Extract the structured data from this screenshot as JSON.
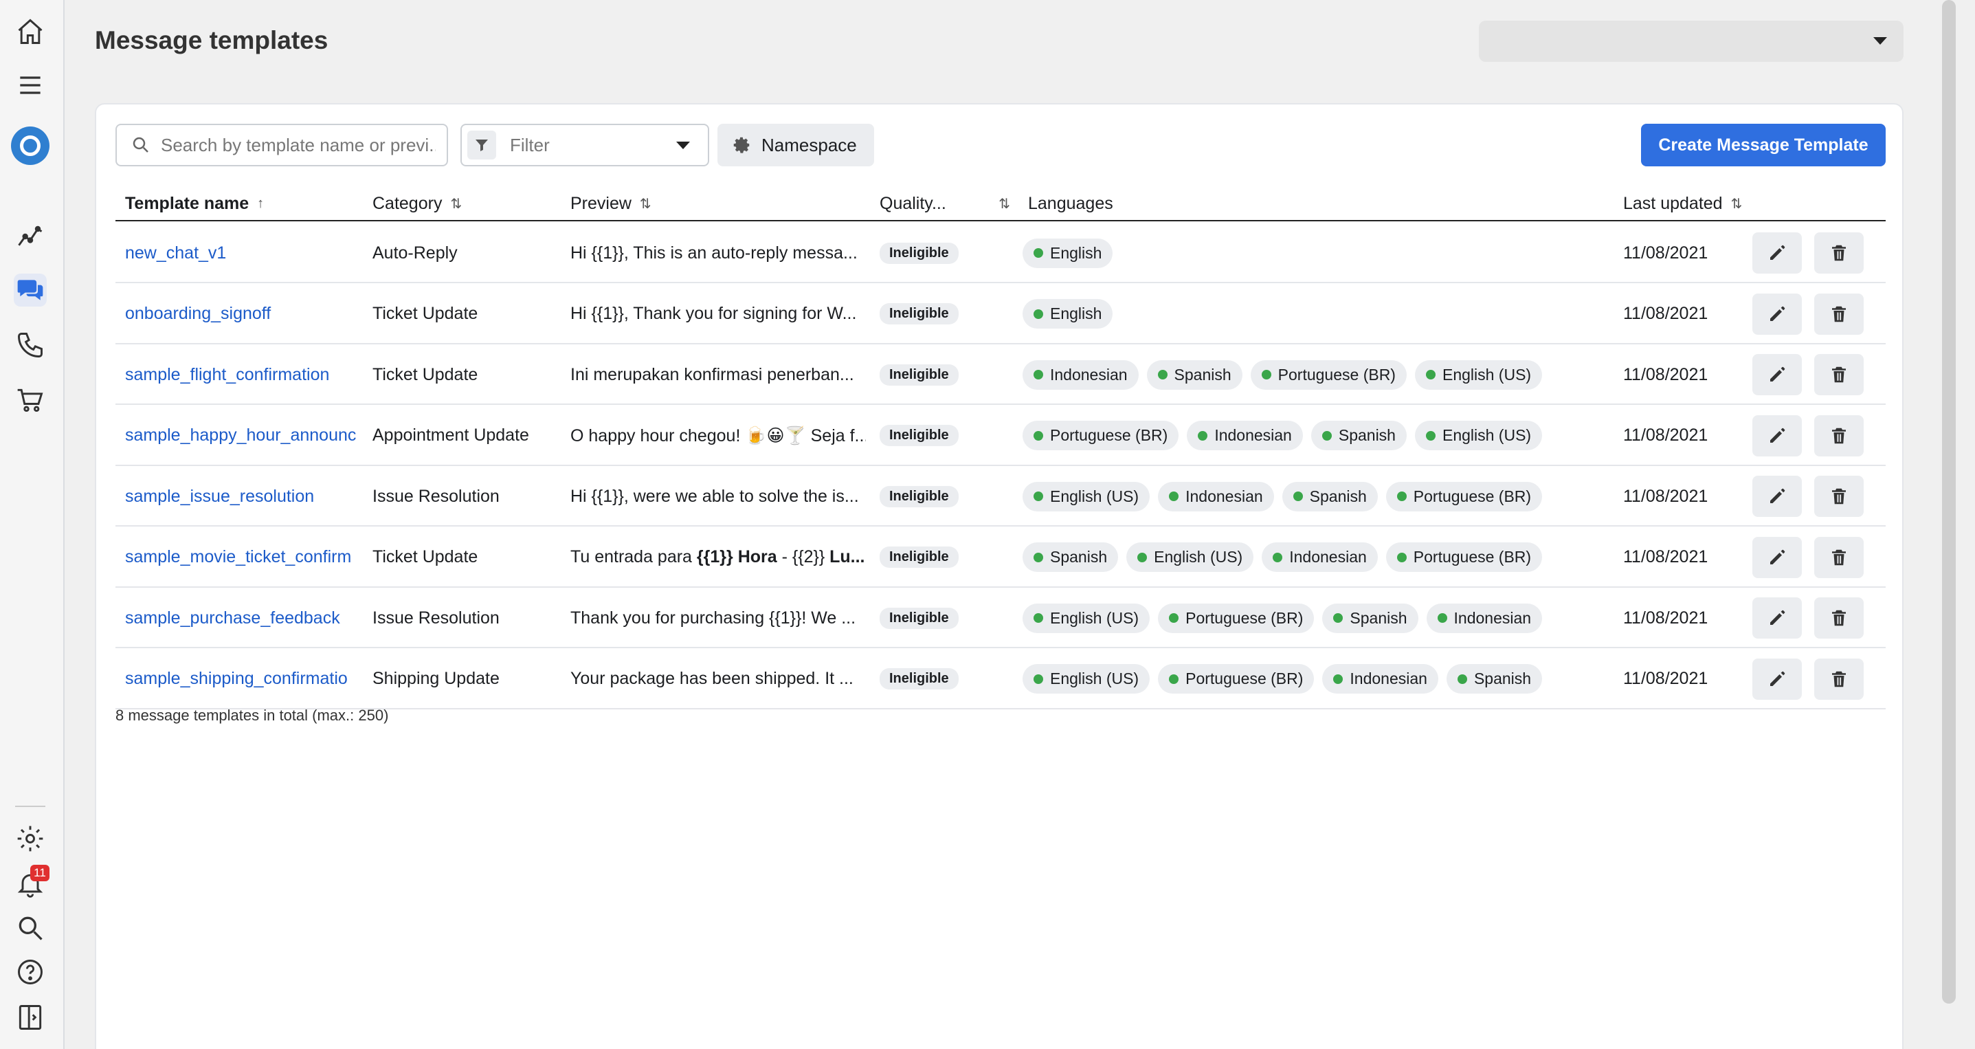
{
  "header": {
    "title": "Message templates",
    "account_select_value": ""
  },
  "sidebar": {
    "icons": [
      "home-icon",
      "menu-icon",
      "brand-logo",
      "analytics-icon",
      "chat-icon",
      "phone-icon",
      "cart-icon",
      "gear-icon",
      "bell-icon",
      "search-icon",
      "help-icon",
      "panel-toggle-icon"
    ],
    "notification_count": "11"
  },
  "toolbar": {
    "search_placeholder": "Search by template name or previ...",
    "filter_placeholder": "Filter",
    "namespace_label": "Namespace",
    "create_label": "Create Message Template"
  },
  "table": {
    "columns": {
      "name": "Template name",
      "category": "Category",
      "preview": "Preview",
      "quality": "Quality...",
      "languages": "Languages",
      "updated": "Last updated"
    },
    "sort_up_glyph": "↑",
    "sort_both_glyph": "⇅",
    "rows": [
      {
        "name": "new_chat_v1",
        "category": "Auto-Reply",
        "preview": "Hi {{1}}, This is an auto-reply messa...",
        "quality": "Ineligible",
        "languages": [
          "English"
        ],
        "updated": "11/08/2021"
      },
      {
        "name": "onboarding_signoff",
        "category": "Ticket Update",
        "preview": "Hi {{1}}, Thank you for signing for W...",
        "quality": "Ineligible",
        "languages": [
          "English"
        ],
        "updated": "11/08/2021"
      },
      {
        "name": "sample_flight_confirmation",
        "category": "Ticket Update",
        "preview": "Ini merupakan konfirmasi penerban...",
        "quality": "Ineligible",
        "languages": [
          "Indonesian",
          "Spanish",
          "Portuguese (BR)",
          "English (US)"
        ],
        "updated": "11/08/2021"
      },
      {
        "name": "sample_happy_hour_announc",
        "category": "Appointment Update",
        "preview": "O happy hour chegou! 🍺😀🍸 Seja f...",
        "quality": "Ineligible",
        "languages": [
          "Portuguese (BR)",
          "Indonesian",
          "Spanish",
          "English (US)"
        ],
        "updated": "11/08/2021"
      },
      {
        "name": "sample_issue_resolution",
        "category": "Issue Resolution",
        "preview": "Hi {{1}}, were we able to solve the is...",
        "quality": "Ineligible",
        "languages": [
          "English (US)",
          "Indonesian",
          "Spanish",
          "Portuguese (BR)"
        ],
        "updated": "11/08/2021"
      },
      {
        "name": "sample_movie_ticket_confirm",
        "category": "Ticket Update",
        "preview_parts": [
          "Tu entrada para ",
          "{{1}} Hora",
          " - {{2}} ",
          "Lu..."
        ],
        "quality": "Ineligible",
        "languages": [
          "Spanish",
          "English (US)",
          "Indonesian",
          "Portuguese (BR)"
        ],
        "updated": "11/08/2021"
      },
      {
        "name": "sample_purchase_feedback",
        "category": "Issue Resolution",
        "preview": "Thank you for purchasing {{1}}! We ...",
        "quality": "Ineligible",
        "languages": [
          "English (US)",
          "Portuguese (BR)",
          "Spanish",
          "Indonesian"
        ],
        "updated": "11/08/2021"
      },
      {
        "name": "sample_shipping_confirmatio",
        "category": "Shipping Update",
        "preview": "Your package has been shipped. It ...",
        "quality": "Ineligible",
        "languages": [
          "English (US)",
          "Portuguese (BR)",
          "Indonesian",
          "Spanish"
        ],
        "updated": "11/08/2021"
      }
    ],
    "total_text": "8 message templates in total (max.: 250)"
  },
  "colors": {
    "accent": "#2f6fe0",
    "link": "#1c5bc9",
    "language_dot": "#3aa64a",
    "badge": "#e02f2f"
  }
}
